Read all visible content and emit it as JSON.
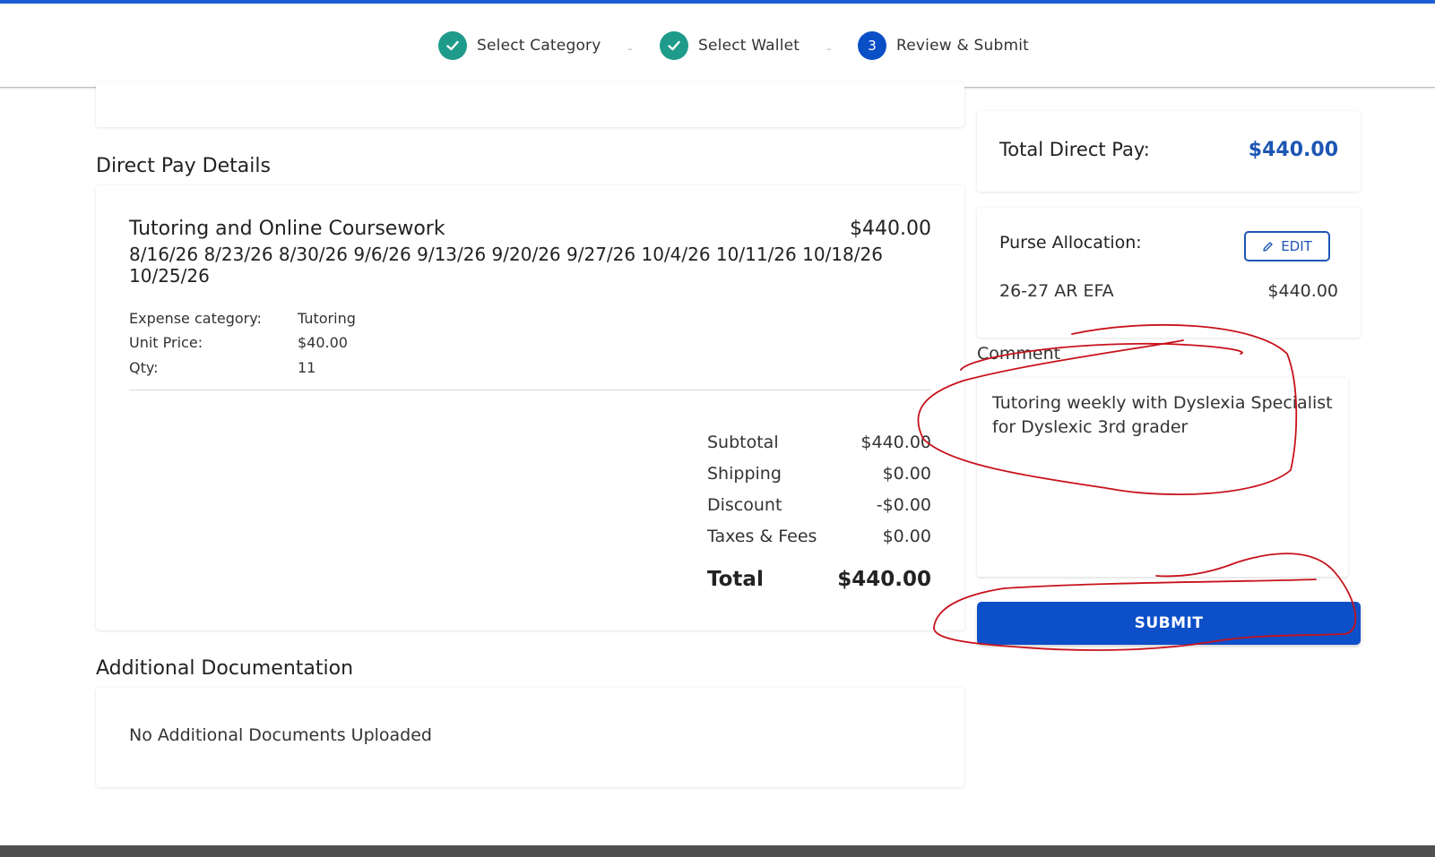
{
  "stepper": {
    "steps": [
      {
        "label": "Select Category",
        "status": "complete"
      },
      {
        "label": "Select Wallet",
        "status": "complete"
      },
      {
        "label": "Review & Submit",
        "status": "current",
        "number": "3"
      }
    ],
    "separator": "–"
  },
  "direct_pay": {
    "section_title": "Direct Pay Details",
    "item": {
      "title": "Tutoring and Online Coursework",
      "price": "$440.00",
      "dates": "8/16/26 8/23/26 8/30/26 9/6/26 9/13/26 9/20/26 9/27/26 10/4/26 10/11/26 10/18/26 10/25/26",
      "expense_category_label": "Expense category:",
      "expense_category_value": "Tutoring",
      "unit_price_label": "Unit Price:",
      "unit_price_value": "$40.00",
      "qty_label": "Qty:",
      "qty_value": "11"
    },
    "summary": {
      "subtotal_label": "Subtotal",
      "subtotal_value": "$440.00",
      "shipping_label": "Shipping",
      "shipping_value": "$0.00",
      "discount_label": "Discount",
      "discount_value": "-$0.00",
      "taxes_label": "Taxes & Fees",
      "taxes_value": "$0.00",
      "total_label": "Total",
      "total_value": "$440.00"
    }
  },
  "additional_docs": {
    "section_title": "Additional Documentation",
    "empty_message": "No Additional Documents Uploaded"
  },
  "sidebar": {
    "total_label": "Total Direct Pay:",
    "total_value": "$440.00",
    "purse_label": "Purse Allocation:",
    "edit_label": "EDIT",
    "purse_name": "26-27 AR EFA",
    "purse_amount": "$440.00",
    "comment_label": "Comment",
    "comment_text": "Tutoring weekly with Dyslexia Specialist for Dyslexic 3rd grader",
    "submit_label": "SUBMIT"
  },
  "colors": {
    "accent": "#1a5fd4",
    "step_complete": "#1e9b8a",
    "step_current": "#0b4fc7",
    "amount_blue": "#1d56b4",
    "submit_bg": "#0d4fc8",
    "annotation_red": "#c8121b"
  },
  "icons": {
    "step_complete": "check-icon",
    "edit": "pencil-icon"
  }
}
